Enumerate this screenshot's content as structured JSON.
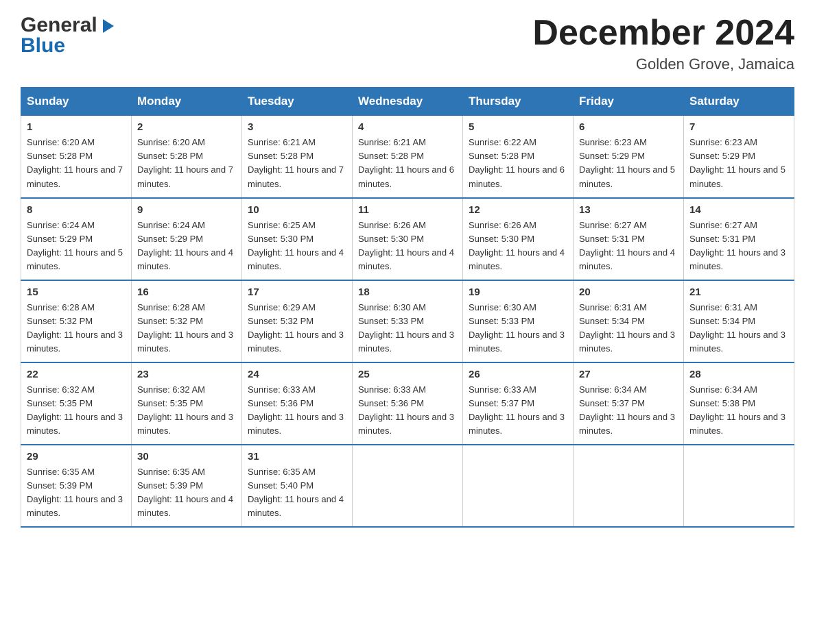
{
  "logo": {
    "general": "General",
    "blue": "Blue"
  },
  "header": {
    "month": "December 2024",
    "location": "Golden Grove, Jamaica"
  },
  "days_of_week": [
    "Sunday",
    "Monday",
    "Tuesday",
    "Wednesday",
    "Thursday",
    "Friday",
    "Saturday"
  ],
  "weeks": [
    [
      {
        "day": "1",
        "sunrise": "6:20 AM",
        "sunset": "5:28 PM",
        "daylight": "11 hours and 7 minutes."
      },
      {
        "day": "2",
        "sunrise": "6:20 AM",
        "sunset": "5:28 PM",
        "daylight": "11 hours and 7 minutes."
      },
      {
        "day": "3",
        "sunrise": "6:21 AM",
        "sunset": "5:28 PM",
        "daylight": "11 hours and 7 minutes."
      },
      {
        "day": "4",
        "sunrise": "6:21 AM",
        "sunset": "5:28 PM",
        "daylight": "11 hours and 6 minutes."
      },
      {
        "day": "5",
        "sunrise": "6:22 AM",
        "sunset": "5:28 PM",
        "daylight": "11 hours and 6 minutes."
      },
      {
        "day": "6",
        "sunrise": "6:23 AM",
        "sunset": "5:29 PM",
        "daylight": "11 hours and 5 minutes."
      },
      {
        "day": "7",
        "sunrise": "6:23 AM",
        "sunset": "5:29 PM",
        "daylight": "11 hours and 5 minutes."
      }
    ],
    [
      {
        "day": "8",
        "sunrise": "6:24 AM",
        "sunset": "5:29 PM",
        "daylight": "11 hours and 5 minutes."
      },
      {
        "day": "9",
        "sunrise": "6:24 AM",
        "sunset": "5:29 PM",
        "daylight": "11 hours and 4 minutes."
      },
      {
        "day": "10",
        "sunrise": "6:25 AM",
        "sunset": "5:30 PM",
        "daylight": "11 hours and 4 minutes."
      },
      {
        "day": "11",
        "sunrise": "6:26 AM",
        "sunset": "5:30 PM",
        "daylight": "11 hours and 4 minutes."
      },
      {
        "day": "12",
        "sunrise": "6:26 AM",
        "sunset": "5:30 PM",
        "daylight": "11 hours and 4 minutes."
      },
      {
        "day": "13",
        "sunrise": "6:27 AM",
        "sunset": "5:31 PM",
        "daylight": "11 hours and 4 minutes."
      },
      {
        "day": "14",
        "sunrise": "6:27 AM",
        "sunset": "5:31 PM",
        "daylight": "11 hours and 3 minutes."
      }
    ],
    [
      {
        "day": "15",
        "sunrise": "6:28 AM",
        "sunset": "5:32 PM",
        "daylight": "11 hours and 3 minutes."
      },
      {
        "day": "16",
        "sunrise": "6:28 AM",
        "sunset": "5:32 PM",
        "daylight": "11 hours and 3 minutes."
      },
      {
        "day": "17",
        "sunrise": "6:29 AM",
        "sunset": "5:32 PM",
        "daylight": "11 hours and 3 minutes."
      },
      {
        "day": "18",
        "sunrise": "6:30 AM",
        "sunset": "5:33 PM",
        "daylight": "11 hours and 3 minutes."
      },
      {
        "day": "19",
        "sunrise": "6:30 AM",
        "sunset": "5:33 PM",
        "daylight": "11 hours and 3 minutes."
      },
      {
        "day": "20",
        "sunrise": "6:31 AM",
        "sunset": "5:34 PM",
        "daylight": "11 hours and 3 minutes."
      },
      {
        "day": "21",
        "sunrise": "6:31 AM",
        "sunset": "5:34 PM",
        "daylight": "11 hours and 3 minutes."
      }
    ],
    [
      {
        "day": "22",
        "sunrise": "6:32 AM",
        "sunset": "5:35 PM",
        "daylight": "11 hours and 3 minutes."
      },
      {
        "day": "23",
        "sunrise": "6:32 AM",
        "sunset": "5:35 PM",
        "daylight": "11 hours and 3 minutes."
      },
      {
        "day": "24",
        "sunrise": "6:33 AM",
        "sunset": "5:36 PM",
        "daylight": "11 hours and 3 minutes."
      },
      {
        "day": "25",
        "sunrise": "6:33 AM",
        "sunset": "5:36 PM",
        "daylight": "11 hours and 3 minutes."
      },
      {
        "day": "26",
        "sunrise": "6:33 AM",
        "sunset": "5:37 PM",
        "daylight": "11 hours and 3 minutes."
      },
      {
        "day": "27",
        "sunrise": "6:34 AM",
        "sunset": "5:37 PM",
        "daylight": "11 hours and 3 minutes."
      },
      {
        "day": "28",
        "sunrise": "6:34 AM",
        "sunset": "5:38 PM",
        "daylight": "11 hours and 3 minutes."
      }
    ],
    [
      {
        "day": "29",
        "sunrise": "6:35 AM",
        "sunset": "5:39 PM",
        "daylight": "11 hours and 3 minutes."
      },
      {
        "day": "30",
        "sunrise": "6:35 AM",
        "sunset": "5:39 PM",
        "daylight": "11 hours and 4 minutes."
      },
      {
        "day": "31",
        "sunrise": "6:35 AM",
        "sunset": "5:40 PM",
        "daylight": "11 hours and 4 minutes."
      },
      null,
      null,
      null,
      null
    ]
  ]
}
